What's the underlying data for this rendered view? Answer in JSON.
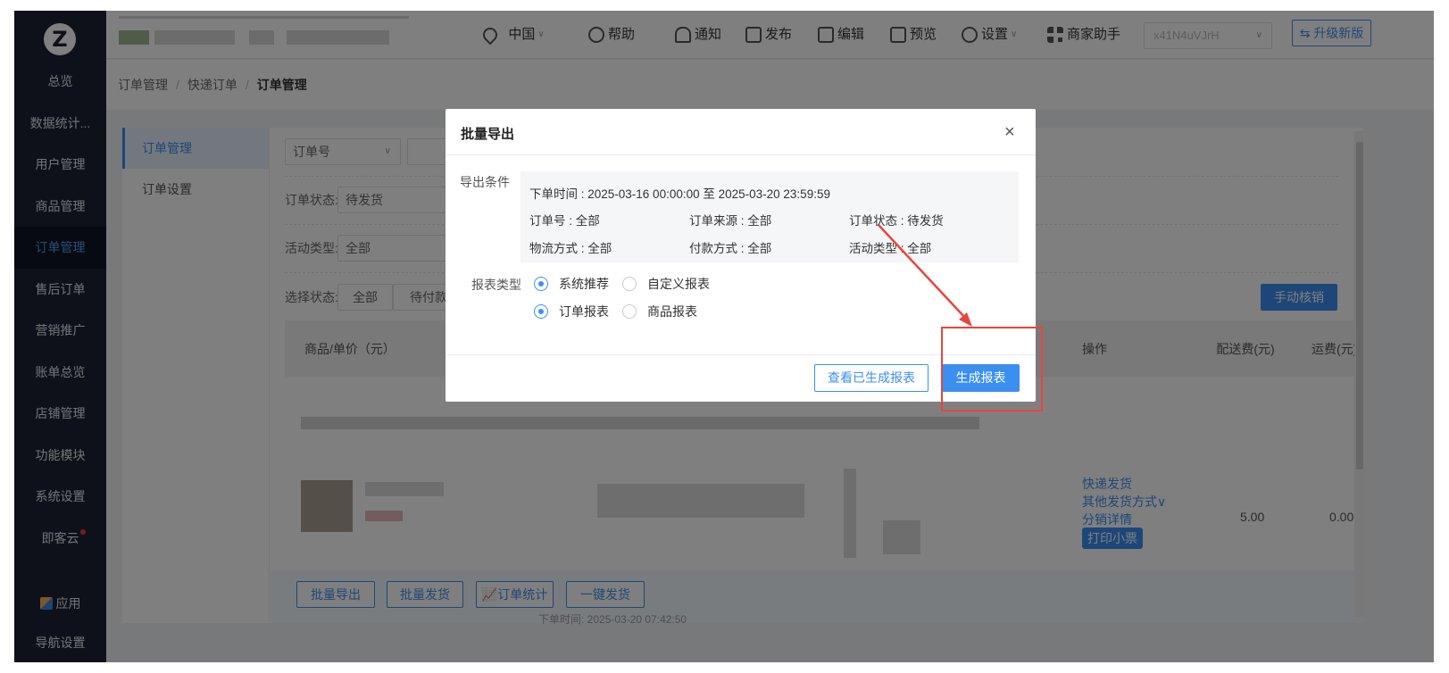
{
  "sidebar": {
    "logo_letter": "Z",
    "items": [
      {
        "label": "总览"
      },
      {
        "label": "数据统计..."
      },
      {
        "label": "用户管理"
      },
      {
        "label": "商品管理"
      },
      {
        "label": "订单管理"
      },
      {
        "label": "售后订单"
      },
      {
        "label": "营销推广"
      },
      {
        "label": "账单总览"
      },
      {
        "label": "店铺管理"
      },
      {
        "label": "功能模块"
      },
      {
        "label": "系统设置"
      },
      {
        "label": "即客云"
      }
    ],
    "apps_label": "应用",
    "nav_settings_label": "导航设置"
  },
  "header": {
    "region": "中国",
    "help": "帮助",
    "notify": "通知",
    "publish": "发布",
    "edit": "编辑",
    "preview": "预览",
    "settings": "设置",
    "assistant": "商家助手",
    "store_select": "x41N4uVJrH",
    "upgrade": "升级新版"
  },
  "breadcrumb": {
    "items": [
      "订单管理",
      "快递订单",
      "订单管理"
    ]
  },
  "subnav": {
    "items": [
      "订单管理",
      "订单设置"
    ]
  },
  "filters": {
    "order_no_select": "订单号",
    "status_label": "订单状态:",
    "status_value": "待发货",
    "activity_label": "活动类型:",
    "activity_value": "全部",
    "select_status_label": "选择状态:",
    "tab_all": "全部",
    "tab_pending_pay": "待付款",
    "manual_verify": "手动核销"
  },
  "table": {
    "col_product": "商品/单价（元）",
    "col_ops": "操作",
    "col_shipping_fee": "配送费(元)",
    "col_freight": "运费(元)",
    "row": {
      "op_express": "快递发货",
      "op_other": "其他发货方式",
      "op_dist": "分销详情",
      "print": "打印小票",
      "shipping_fee": "5.00",
      "freight": "0.00"
    }
  },
  "bottom_bar": {
    "batch_export": "批量导出",
    "batch_ship": "批量发货",
    "order_stats": "订单统计",
    "one_click_ship": "一键发货",
    "timestamp": "下单时间: 2025-03-20 07:42:50"
  },
  "modal": {
    "title": "批量导出",
    "close_glyph": "×",
    "condition_label": "导出条件",
    "time_range": "下单时间 : 2025-03-16 00:00:00 至 2025-03-20 23:59:59",
    "cond_order_no": "订单号 : 全部",
    "cond_source": "订单来源 : 全部",
    "cond_status": "订单状态 : 待发货",
    "cond_logistics": "物流方式 : 全部",
    "cond_payment": "付款方式 : 全部",
    "cond_activity": "活动类型 : 全部",
    "report_type_label": "报表类型",
    "radio_system": "系统推荐",
    "radio_custom": "自定义报表",
    "radio_order": "订单报表",
    "radio_product": "商品报表",
    "view_generated": "查看已生成报表",
    "generate": "生成报表"
  },
  "colors": {
    "primary": "#3b8ff0",
    "sidebar_bg": "#1c2233",
    "annotation": "#e8453c"
  }
}
